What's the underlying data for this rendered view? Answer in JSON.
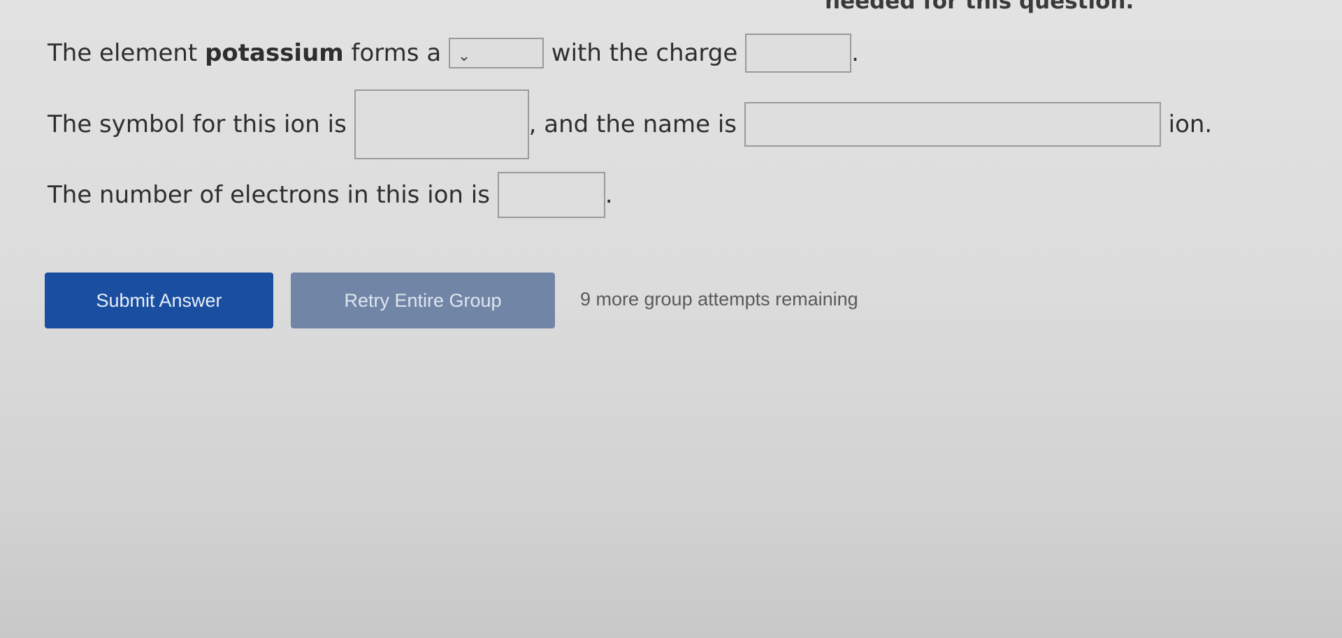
{
  "header": {
    "cutoff_text": "needed for this question."
  },
  "question": {
    "line1": {
      "prefix": "The element ",
      "element": "potassium",
      "mid": " forms a ",
      "after_select": " with the charge ",
      "end": "."
    },
    "line2": {
      "prefix": "The symbol for this ion is ",
      "mid": ", and the name is ",
      "end": " ion."
    },
    "line3": {
      "prefix": "The number of electrons in this ion is ",
      "end": "."
    },
    "ion_type_select": {
      "value": ""
    },
    "charge_input": {
      "value": ""
    },
    "symbol_input": {
      "value": ""
    },
    "name_input": {
      "value": ""
    },
    "electrons_input": {
      "value": ""
    }
  },
  "actions": {
    "submit_label": "Submit Answer",
    "retry_label": "Retry Entire Group",
    "attempts_text": "9 more group attempts remaining"
  },
  "colors": {
    "submit_bg": "#1a4ea0",
    "retry_bg": "#7186a6"
  },
  "icons": {
    "select_arrow": "chevron-down-icon"
  }
}
